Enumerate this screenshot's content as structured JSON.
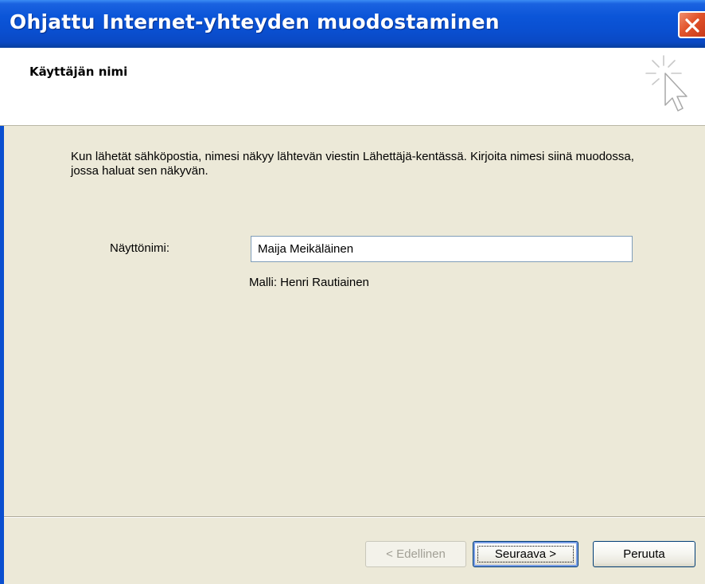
{
  "window": {
    "title": "Ohjattu Internet-yhteyden muodostaminen"
  },
  "header": {
    "title": "Käyttäjän nimi",
    "icon": "wizard-cursor-icon"
  },
  "content": {
    "description": "Kun lähetät sähköpostia, nimesi näkyy lähtevän viestin Lähettäjä-kentässä. Kirjoita nimesi siinä muodossa, jossa haluat sen näkyvän.",
    "display_name_label": "Näyttönimi:",
    "display_name_value": "Maija Meikäläinen",
    "example_text": "Malli: Henri Rautiainen"
  },
  "buttons": {
    "back": "< Edellinen",
    "next": "Seuraava >",
    "cancel": "Peruuta"
  },
  "colors": {
    "titlebar": "#0a4fd0",
    "dialog_bg": "#ece9d8",
    "close_button": "#e2542b"
  }
}
